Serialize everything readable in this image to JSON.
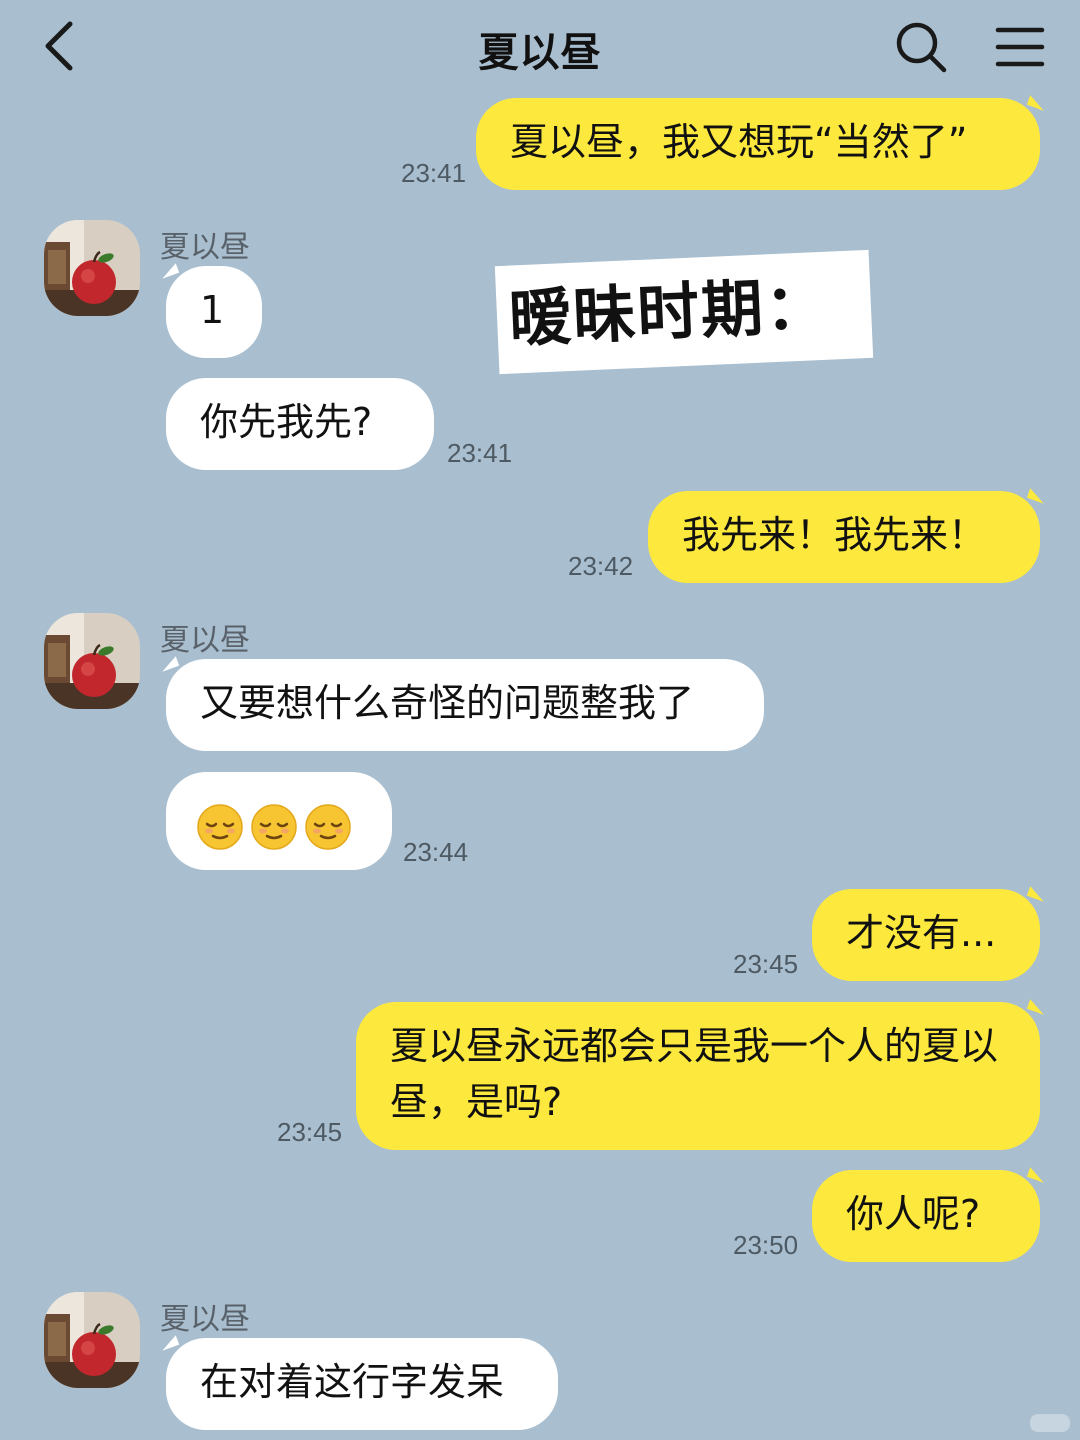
{
  "header": {
    "title": "夏以昼",
    "back_icon": "chevron-left-icon",
    "search_icon": "search-icon",
    "menu_icon": "menu-icon"
  },
  "overlay": {
    "sticker_text": "暧昧时期："
  },
  "contact": {
    "name": "夏以昼",
    "avatar_icon": "apple-avatar-icon"
  },
  "colors": {
    "background": "#a9bfd0",
    "my_bubble": "#fde93d",
    "their_bubble": "#ffffff"
  },
  "messages": [
    {
      "from": "me",
      "text": "夏以昼，我又想玩“当然了”",
      "time": "23:41"
    },
    {
      "from": "them",
      "sender": "夏以昼",
      "text": "1"
    },
    {
      "from": "them",
      "text": "你先我先?",
      "time": "23:41"
    },
    {
      "from": "me",
      "text": "我先来！我先来！",
      "time": "23:42"
    },
    {
      "from": "them",
      "sender": "夏以昼",
      "text": "又要想什么奇怪的问题整我了"
    },
    {
      "from": "them",
      "emoji": [
        "relieved-face-icon",
        "relieved-face-icon",
        "relieved-face-icon"
      ],
      "time": "23:44"
    },
    {
      "from": "me",
      "text": "才没有...",
      "time": "23:45"
    },
    {
      "from": "me",
      "text": "夏以昼永远都会只是我一个人的夏以昼，是吗?",
      "time": "23:45"
    },
    {
      "from": "me",
      "text": "你人呢?",
      "time": "23:50"
    },
    {
      "from": "them",
      "sender": "夏以昼",
      "text": "在对着这行字发呆"
    }
  ]
}
